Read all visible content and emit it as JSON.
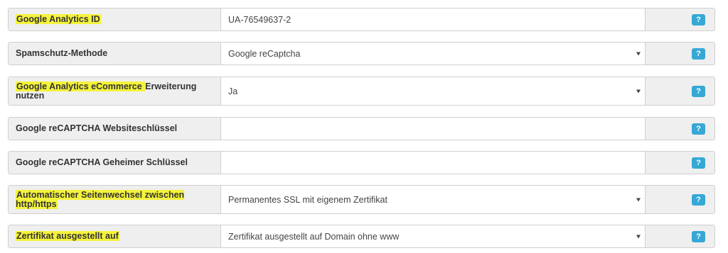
{
  "rows": [
    {
      "label_parts": [
        {
          "text": "Google Analytics ID",
          "hl": true
        }
      ],
      "value": "UA-76549637-2",
      "dropdown": false
    },
    {
      "label_parts": [
        {
          "text": "Spamschutz-Methode",
          "hl": false
        }
      ],
      "value": "Google reCaptcha",
      "dropdown": true
    },
    {
      "label_parts": [
        {
          "text": "Google Analytics eCommerce ",
          "hl": true
        },
        {
          "text": "Erweiterung nutzen",
          "hl": false
        }
      ],
      "value": "Ja",
      "dropdown": true
    },
    {
      "label_parts": [
        {
          "text": "Google reCAPTCHA Websiteschlüssel",
          "hl": false
        }
      ],
      "value": "",
      "dropdown": false
    },
    {
      "label_parts": [
        {
          "text": "Google reCAPTCHA Geheimer Schlüssel",
          "hl": false
        }
      ],
      "value": "",
      "dropdown": false
    },
    {
      "label_parts": [
        {
          "text": "Automatischer Seitenwechsel zwischen http/https",
          "hl": true
        }
      ],
      "value": "Permanentes SSL mit eigenem Zertifikat",
      "dropdown": true
    },
    {
      "label_parts": [
        {
          "text": "Zertifikat ausgestellt auf",
          "hl": true
        }
      ],
      "value": "Zertifikat ausgestellt auf Domain ohne www",
      "dropdown": true
    }
  ],
  "help_label": "?",
  "colors": {
    "highlight": "#f4f33b",
    "help_button": "#36a8d6",
    "label_bg": "#efefef"
  }
}
